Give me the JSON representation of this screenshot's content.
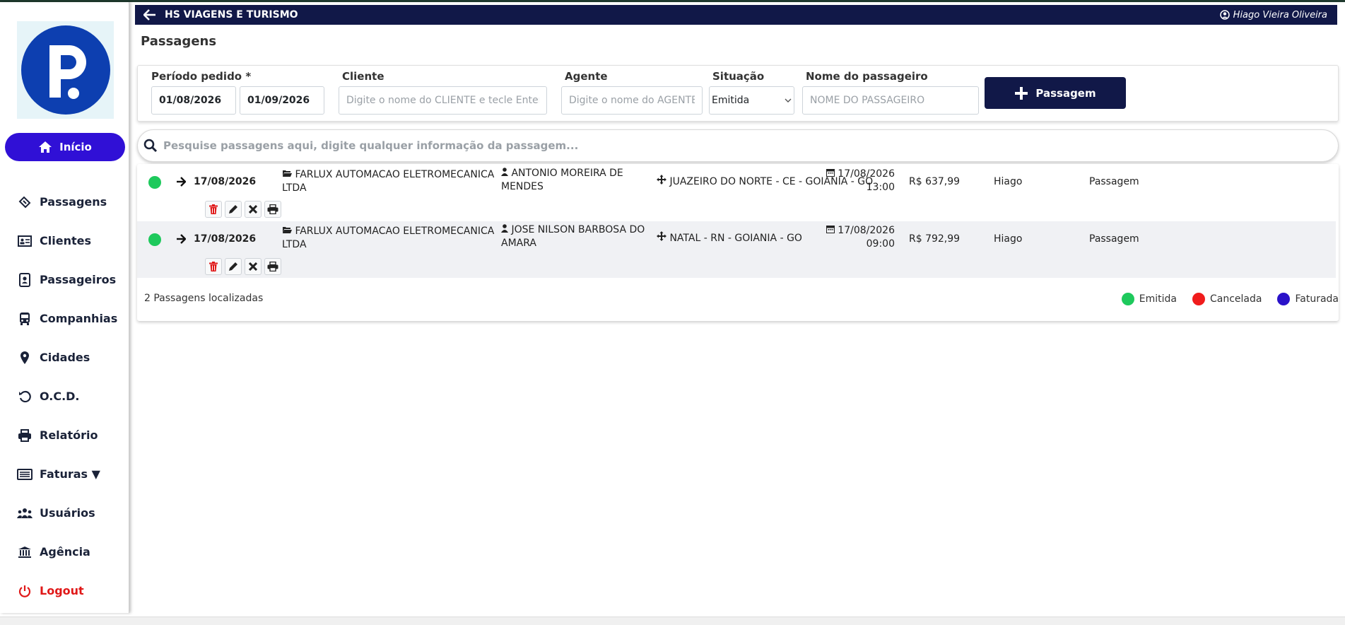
{
  "header": {
    "title": "HS VIAGENS E TURISMO",
    "user": "Hiago Vieira Oliveira"
  },
  "page": {
    "title": "Passagens"
  },
  "sidebar": {
    "home_label": "Início",
    "items": [
      {
        "label": "Passagens",
        "icon": "ticket-icon"
      },
      {
        "label": "Clientes",
        "icon": "id-card-icon"
      },
      {
        "label": "Passageiros",
        "icon": "contact-card-icon"
      },
      {
        "label": "Companhias",
        "icon": "bus-icon"
      },
      {
        "label": "Cidades",
        "icon": "map-pin-icon"
      },
      {
        "label": "O.C.D.",
        "icon": "undo-icon"
      },
      {
        "label": "Relatório",
        "icon": "printer-icon"
      },
      {
        "label": "Faturas ▼",
        "icon": "invoice-icon"
      },
      {
        "label": "Usuários",
        "icon": "users-icon"
      },
      {
        "label": "Agência",
        "icon": "bank-icon"
      },
      {
        "label": "Logout",
        "icon": "power-icon"
      }
    ]
  },
  "filters": {
    "periodo_label": "Período pedido *",
    "date_from": "01/08/2026",
    "date_to": "01/09/2026",
    "cliente_label": "Cliente",
    "cliente_placeholder": "Digite o nome do CLIENTE e tecle Enter",
    "agente_label": "Agente",
    "agente_placeholder": "Digite o nome do AGENTE e tecle Enter",
    "situacao_label": "Situação",
    "situacao_value": "Emitida",
    "passageiro_label": "Nome do passageiro",
    "passageiro_placeholder": "NOME DO PASSAGEIRO",
    "add_button": "Passagem"
  },
  "search": {
    "placeholder": "Pesquise passagens aqui, digite qualquer informação da passagem..."
  },
  "rows": [
    {
      "status_color": "#1ec95c",
      "date": "17/08/2026",
      "client_line1": "FARLUX AUTOMACAO ELETROMECANICA",
      "client_line2": "LTDA",
      "passenger_line1": "ANTONIO MOREIRA DE",
      "passenger_line2": "MENDES",
      "route": "JUAZEIRO DO NORTE - CE - GOIANIA - GO",
      "travel_date": "17/08/2026",
      "travel_time": "13:00",
      "price": "R$ 637,99",
      "agent": "Hiago",
      "type": "Passagem"
    },
    {
      "status_color": "#1ec95c",
      "date": "17/08/2026",
      "client_line1": "FARLUX AUTOMACAO ELETROMECANICA",
      "client_line2": "LTDA",
      "passenger_line1": "JOSE NILSON BARBOSA DO",
      "passenger_line2": "AMARA",
      "route": "NATAL - RN - GOIANIA - GO",
      "travel_date": "17/08/2026",
      "travel_time": "09:00",
      "price": "R$ 792,99",
      "agent": "Hiago",
      "type": "Passagem"
    }
  ],
  "footer": {
    "count": "2 Passagens localizadas"
  },
  "legend": [
    {
      "label": "Emitida",
      "color": "#1ec95c"
    },
    {
      "label": "Cancelada",
      "color": "#f01c1c"
    },
    {
      "label": "Faturada",
      "color": "#2a12c9"
    }
  ]
}
